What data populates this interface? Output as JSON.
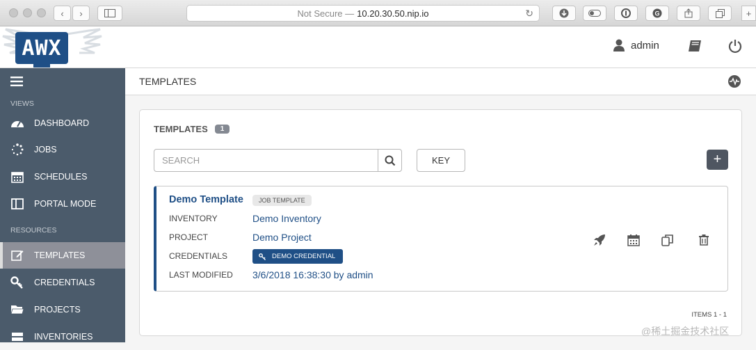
{
  "browser": {
    "security": "Not Secure —",
    "host": "10.20.30.50.nip.io"
  },
  "header": {
    "logo": "AWX",
    "user": "admin"
  },
  "sidebar": {
    "views_heading": "VIEWS",
    "resources_heading": "RESOURCES",
    "items": [
      {
        "label": "DASHBOARD",
        "icon": "dashboard-icon"
      },
      {
        "label": "JOBS",
        "icon": "jobs-spinner-icon"
      },
      {
        "label": "SCHEDULES",
        "icon": "calendar-icon"
      },
      {
        "label": "PORTAL MODE",
        "icon": "portal-icon"
      },
      {
        "label": "TEMPLATES",
        "icon": "edit-icon",
        "active": true
      },
      {
        "label": "CREDENTIALS",
        "icon": "key-icon"
      },
      {
        "label": "PROJECTS",
        "icon": "folder-icon"
      },
      {
        "label": "INVENTORIES",
        "icon": "inventory-icon"
      }
    ]
  },
  "main": {
    "breadcrumb": "TEMPLATES",
    "panel_title": "TEMPLATES",
    "count": "1",
    "search_placeholder": "SEARCH",
    "key_label": "KEY",
    "add_label": "+",
    "items_label": "ITEMS  1 - 1"
  },
  "template": {
    "name": "Demo Template",
    "type": "JOB TEMPLATE",
    "inventory_label": "INVENTORY",
    "inventory": "Demo Inventory",
    "project_label": "PROJECT",
    "project": "Demo Project",
    "credentials_label": "CREDENTIALS",
    "credential": "DEMO CREDENTIAL",
    "modified_label": "LAST MODIFIED",
    "modified": "3/6/2018 16:38:30 by admin"
  },
  "watermark": "@稀土掘金技术社区",
  "colors": {
    "accent": "#1f4f86",
    "sidebar": "#4b5b6b",
    "active_item": "#8e9099"
  }
}
